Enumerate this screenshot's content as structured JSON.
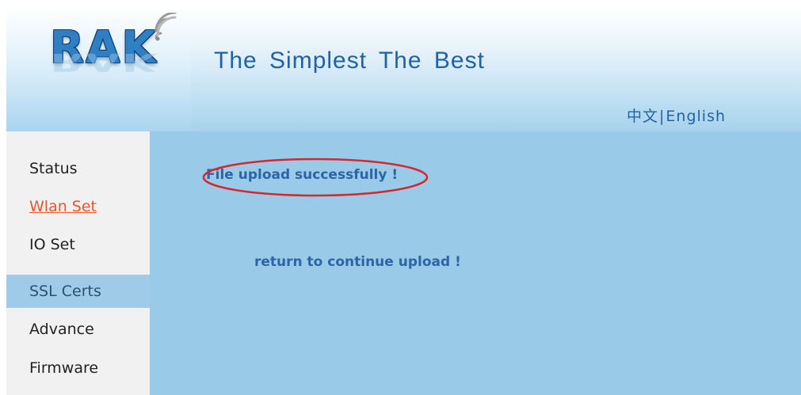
{
  "header": {
    "logo_text": "RAK",
    "slogan": "The Simplest The Best",
    "lang_chinese": "中文",
    "lang_separator": "|",
    "lang_english": "English"
  },
  "sidebar": {
    "items": [
      {
        "label": "Status",
        "state": "normal"
      },
      {
        "label": "Wlan Set",
        "state": "active-link"
      },
      {
        "label": "IO Set",
        "state": "normal"
      },
      {
        "label": "SSL Certs",
        "state": "selected"
      },
      {
        "label": "Advance",
        "state": "normal"
      },
      {
        "label": "Firmware",
        "state": "normal"
      }
    ]
  },
  "main": {
    "success_message": "File upload successfully !",
    "return_link": "return to continue upload !"
  },
  "colors": {
    "brand_blue": "#2f7fc3",
    "text_blue": "#2d64a8",
    "content_bg": "#99cbe8",
    "sidebar_bg": "#f1f1f1",
    "selected_bg": "#a0cbe8",
    "active_link": "#e8552a",
    "highlight_ellipse": "#d9262c"
  },
  "icons": {
    "wifi": "wifi-signal-icon"
  }
}
